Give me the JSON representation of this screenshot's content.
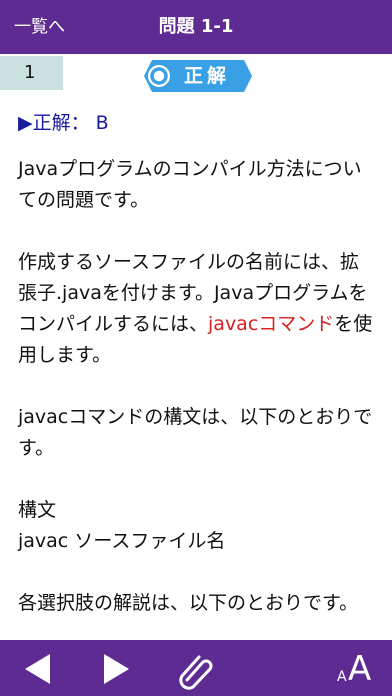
{
  "header": {
    "back_label": "一覧へ",
    "title": "問題 1-1"
  },
  "question_number": "1",
  "badge": {
    "label": "正解",
    "color": "#3aa0e6"
  },
  "answer_line": "▶正解： B",
  "content": {
    "p1": "Javaプログラムのコンパイル方法についての問題です。",
    "p2_before": "作成するソースファイルの名前には、拡張子.javaを付けます。Javaプログラムをコンパイルするには、",
    "p2_highlight": "javacコマンド",
    "p2_after": "を使用します。",
    "p3": "javacコマンドの構文は、以下のとおりです。",
    "p4_head": "構文",
    "p4_body": "javac ソースファイル名",
    "p5": "各選択肢の解説は、以下のとおりです。"
  },
  "footer": {
    "prev_icon": "triangle-left-icon",
    "next_icon": "triangle-right-icon",
    "attach_icon": "paperclip-icon",
    "font_icon": "font-size-icon",
    "font_small": "A",
    "font_large": "A"
  },
  "colors": {
    "brand": "#5e2b93",
    "highlight": "#d8201f",
    "answer": "#1a1aa0",
    "qnum_bg": "#c9e2e0"
  }
}
